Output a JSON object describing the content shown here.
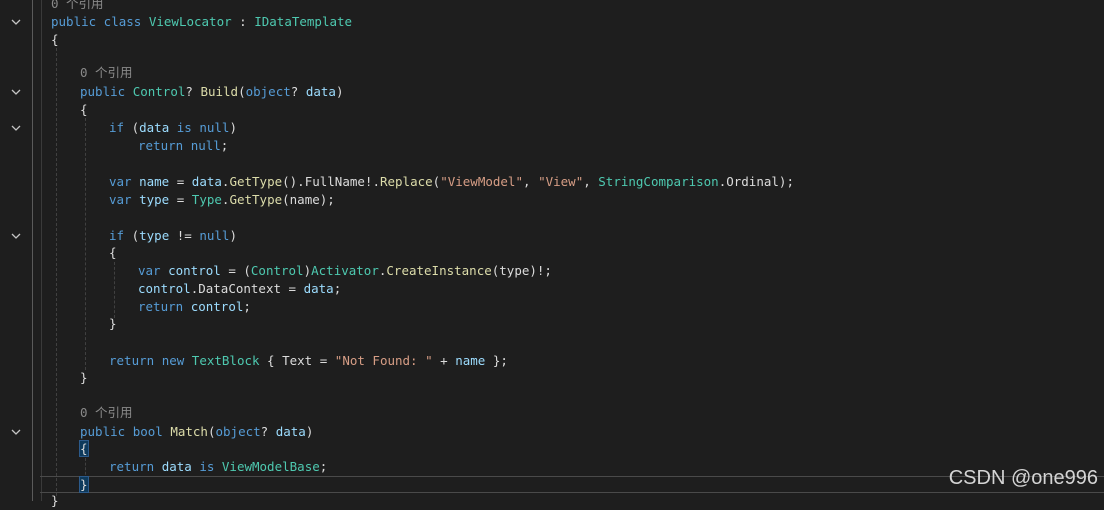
{
  "editor": {
    "theme_colors": {
      "background": "#1e1e1e",
      "keyword": "#569cd6",
      "type": "#4ec9b0",
      "method": "#dcdcaa",
      "identifier": "#9cdcfe",
      "string": "#d69d85",
      "plain": "#dcdcdc",
      "codelens": "#8a8a8a"
    },
    "references_label": "0 个引用",
    "code": {
      "class_keywords": "public class",
      "class_name": "ViewLocator",
      "class_colon": " : ",
      "interface_name": "IDataTemplate",
      "brace_open": "{",
      "brace_close": "}",
      "build_public": "public",
      "build_return_type": "Control",
      "build_nullable": "?",
      "build_name": "Build",
      "paren_open": "(",
      "param_type": "object",
      "param_rest": "? ",
      "param_name": "data",
      "paren_close": ")",
      "if_kw": "if",
      "if1_open": " (",
      "data_ident": "data",
      "is_kw": " is ",
      "null_kw": "null",
      "if1_close": ")",
      "return_kw": "return",
      "return_null": "null",
      "semicolon": ";",
      "var_kw": "var",
      "name_ident": "name",
      "equals": " = ",
      "get_type": "GetType",
      "empty_call_dot": "().",
      "full_name": "FullName",
      "bang_dot": "!.",
      "replace_name": "Replace",
      "str_viewmodel": "\"ViewModel\"",
      "comma": ", ",
      "str_view": "\"View\"",
      "string_comparison": "StringComparison",
      "dot": ".",
      "ordinal": "Ordinal",
      "close_semicolon": ");",
      "type_ident": "type",
      "type_class": "Type",
      "name_arg": "(name);",
      "ne_null": " != ",
      "control_ident": "control",
      "cast_open": "(",
      "control_type": "Control",
      "cast_close": ")",
      "activator": "Activator",
      "create_instance": "CreateInstance",
      "type_arg": "(type)!;",
      "data_context": "DataContext",
      "new_kw": "new",
      "text_block": "TextBlock",
      "init_open": " { ",
      "text_prop": "Text",
      "str_not_found": "\"Not Found: \"",
      "plus": " + ",
      "init_close": " };",
      "match_public": "public",
      "bool_kw": "bool",
      "match_name": "Match",
      "view_model_base": "ViewModelBase"
    }
  },
  "watermark": "CSDN @one996"
}
